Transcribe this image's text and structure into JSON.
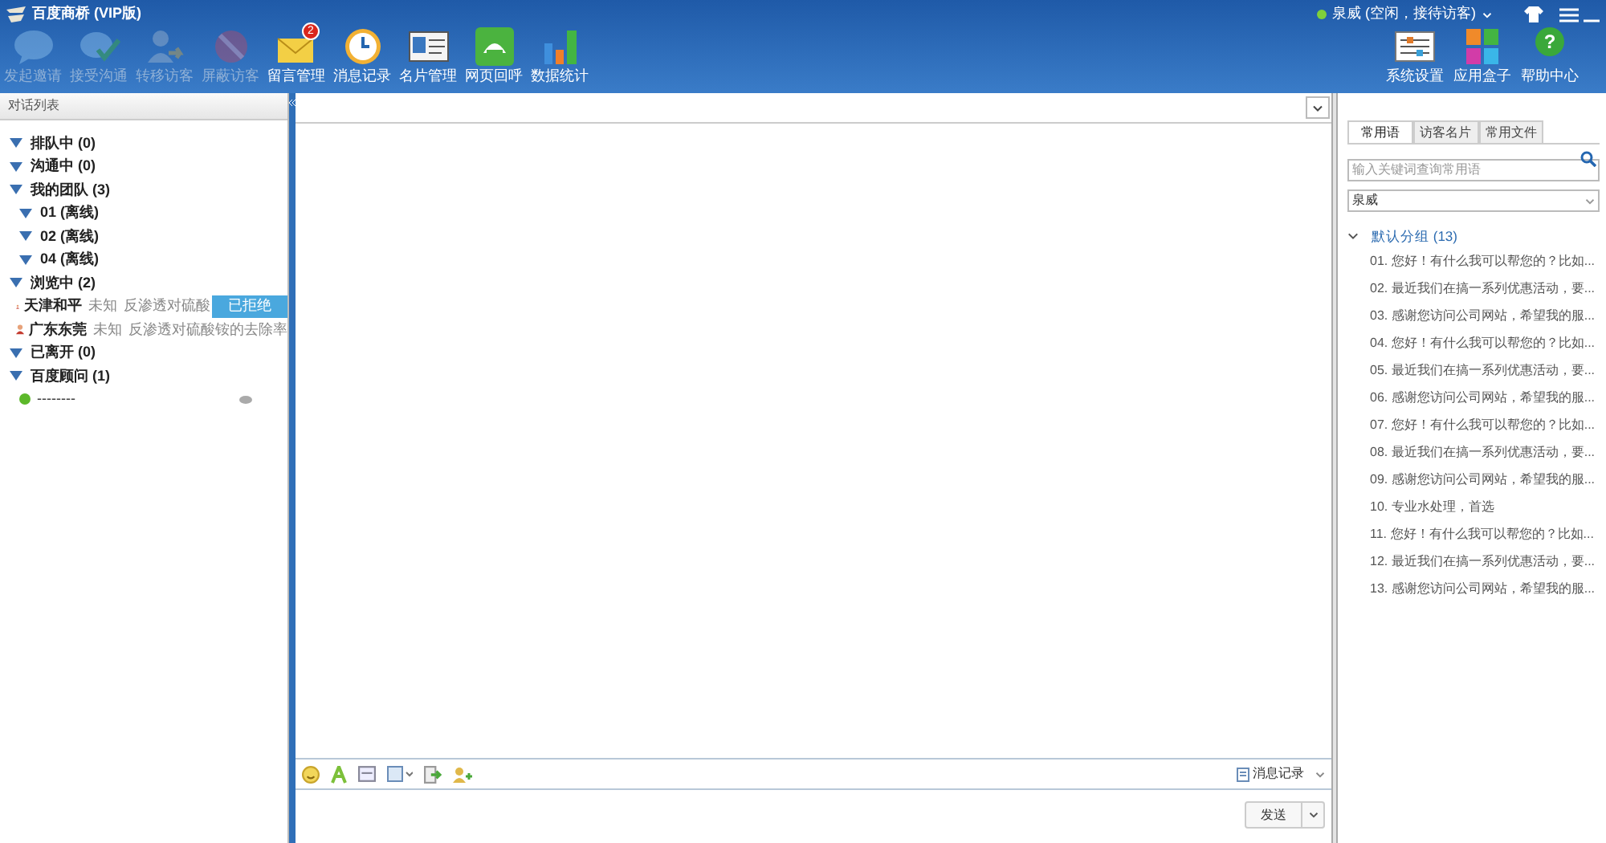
{
  "window": {
    "title": "百度商桥 (VIP版)"
  },
  "user_status": {
    "label": "泉威 (空闲，接待访客)",
    "online": true
  },
  "toolbar": [
    {
      "label": "发起邀请",
      "disabled": true
    },
    {
      "label": "接受沟通",
      "disabled": true
    },
    {
      "label": "转移访客",
      "disabled": true
    },
    {
      "label": "屏蔽访客",
      "disabled": true
    },
    {
      "label": "留言管理",
      "disabled": false,
      "badge": "2"
    },
    {
      "label": "消息记录",
      "disabled": false
    },
    {
      "label": "名片管理",
      "disabled": false
    },
    {
      "label": "网页回呼",
      "disabled": false
    },
    {
      "label": "数据统计",
      "disabled": false
    }
  ],
  "toolbar_right": [
    {
      "label": "系统设置"
    },
    {
      "label": "应用盒子"
    },
    {
      "label": "帮助中心",
      "glyph": "?"
    }
  ],
  "sidebar": {
    "title": "对话列表",
    "tree": [
      {
        "kind": "group",
        "label": "排队中 (0)",
        "expanded": true
      },
      {
        "kind": "group",
        "label": "沟通中 (0)",
        "expanded": true
      },
      {
        "kind": "group",
        "label": "我的团队 (3)",
        "expanded": true,
        "children": [
          {
            "kind": "group",
            "label": "01 (离线)",
            "expanded": true
          },
          {
            "kind": "group",
            "label": "02 (离线)",
            "expanded": true
          },
          {
            "kind": "group",
            "label": "04 (离线)",
            "expanded": true
          }
        ]
      },
      {
        "kind": "group",
        "label": "浏览中 (2)",
        "expanded": true,
        "children": [
          {
            "kind": "visitor",
            "location": "天津和平",
            "status": "未知",
            "text": "反渗透对硫酸",
            "tag": "已拒绝"
          },
          {
            "kind": "visitor",
            "location": "广东东莞",
            "status": "未知",
            "text": "反渗透对硫酸铵的去除率"
          }
        ]
      },
      {
        "kind": "group",
        "label": "已离开 (0)",
        "expanded": true
      },
      {
        "kind": "group",
        "label": "百度顾问 (1)",
        "expanded": true,
        "children": [
          {
            "kind": "agent",
            "name": "--------",
            "online": true
          }
        ]
      }
    ]
  },
  "right_panel": {
    "tabs": [
      {
        "label": "常用语",
        "selected": true
      },
      {
        "label": "访客名片",
        "selected": false
      },
      {
        "label": "常用文件",
        "selected": false
      }
    ],
    "search": {
      "placeholder": "输入关键词查询常用语"
    },
    "owner_select": {
      "value": "泉威"
    },
    "group": {
      "label": "默认分组 (13)",
      "expanded": true,
      "items": [
        "01. 您好！有什么我可以帮您的？比如...",
        "02. 最近我们在搞一系列优惠活动，要...",
        "03. 感谢您访问公司网站，希望我的服...",
        "04. 您好！有什么我可以帮您的？比如...",
        "05. 最近我们在搞一系列优惠活动，要...",
        "06. 感谢您访问公司网站，希望我的服...",
        "07. 您好！有什么我可以帮您的？比如...",
        "08. 最近我们在搞一系列优惠活动，要...",
        "09. 感谢您访问公司网站，希望我的服...",
        "10. 专业水处理，首选",
        "11. 您好！有什么我可以帮您的？比如...",
        "12. 最近我们在搞一系列优惠活动，要...",
        "13. 感谢您访问公司网站，希望我的服..."
      ]
    }
  },
  "composer": {
    "history_button": "消息记录",
    "send_button": "发送"
  }
}
